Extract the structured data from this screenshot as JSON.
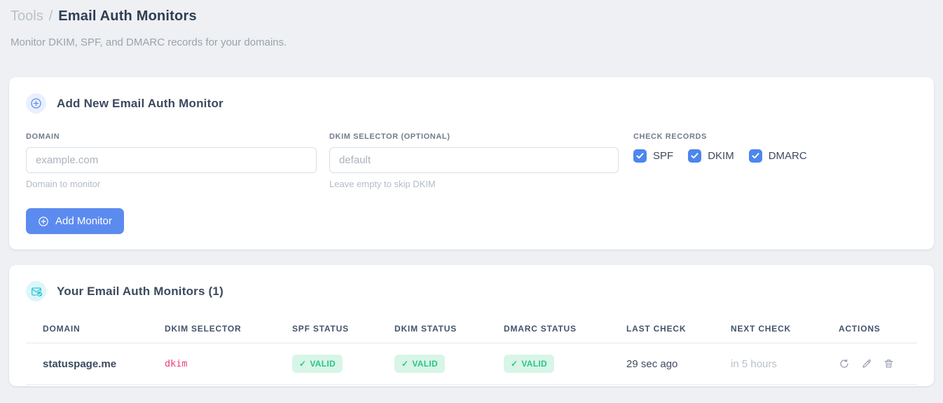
{
  "breadcrumb": {
    "section": "Tools",
    "separator": "/",
    "page": "Email Auth Monitors"
  },
  "subtitle": "Monitor DKIM, SPF, and DMARC records for your domains.",
  "icons": {
    "check": "✓"
  },
  "colors": {
    "accent_blue": "#5c8bf0",
    "checkbox_blue": "#4c86ee",
    "cyan": "#2bc7d9",
    "badge_green_bg": "#d8f5e7",
    "badge_green_text": "#27c688",
    "selector_pink": "#ed3d7f"
  },
  "add_card": {
    "title": "Add New Email Auth Monitor",
    "domain_field": {
      "label": "DOMAIN",
      "placeholder": "example.com",
      "value": "",
      "helper": "Domain to monitor"
    },
    "dkim_field": {
      "label": "DKIM SELECTOR (OPTIONAL)",
      "placeholder": "default",
      "value": "",
      "helper": "Leave empty to skip DKIM"
    },
    "check_records": {
      "label": "CHECK RECORDS",
      "options": [
        {
          "label": "SPF",
          "checked": true
        },
        {
          "label": "DKIM",
          "checked": true
        },
        {
          "label": "DMARC",
          "checked": true
        }
      ]
    },
    "submit_label": "Add Monitor"
  },
  "monitors_card": {
    "title": "Your Email Auth Monitors (1)",
    "table": {
      "headers": [
        "DOMAIN",
        "DKIM SELECTOR",
        "SPF STATUS",
        "DKIM STATUS",
        "DMARC STATUS",
        "LAST CHECK",
        "NEXT CHECK",
        "ACTIONS"
      ],
      "rows": [
        {
          "domain": "statuspage.me",
          "dkim_selector": "dkim",
          "spf_status": "VALID",
          "dkim_status": "VALID",
          "dmarc_status": "VALID",
          "last_check": "29 sec ago",
          "next_check": "in 5 hours"
        }
      ]
    }
  }
}
